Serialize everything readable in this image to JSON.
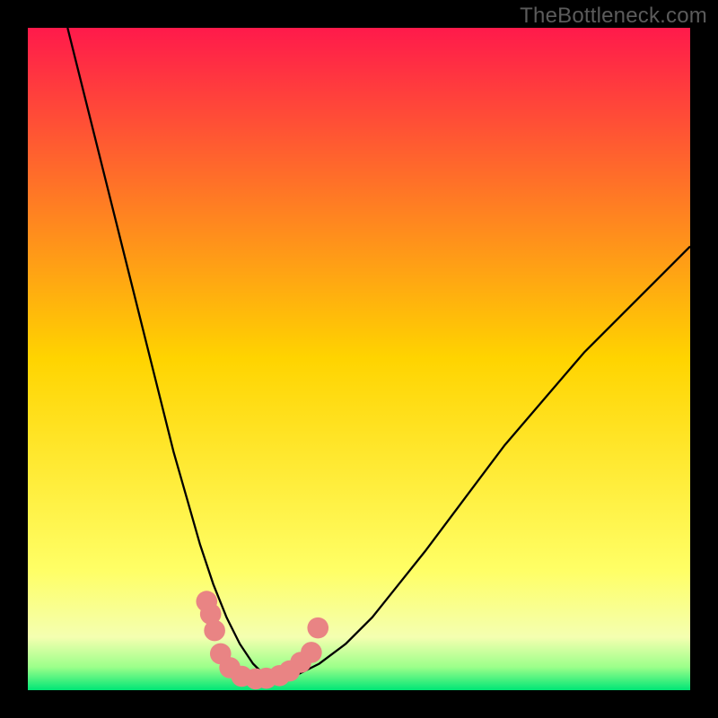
{
  "watermark": "TheBottleneck.com",
  "chart_data": {
    "type": "line",
    "title": "",
    "xlabel": "",
    "ylabel": "",
    "xlim": [
      0,
      100
    ],
    "ylim": [
      0,
      100
    ],
    "grid": false,
    "gradient_stops": [
      {
        "offset": 0,
        "color": "#ff1a4b"
      },
      {
        "offset": 50,
        "color": "#ffd400"
      },
      {
        "offset": 82,
        "color": "#ffff66"
      },
      {
        "offset": 92,
        "color": "#f4ffb0"
      },
      {
        "offset": 96.5,
        "color": "#9cff8a"
      },
      {
        "offset": 100,
        "color": "#00e676"
      }
    ],
    "series": [
      {
        "name": "bottleneck-curve",
        "x": [
          6,
          8,
          10,
          12,
          14,
          16,
          18,
          20,
          22,
          24,
          26,
          28,
          30,
          32,
          34,
          36,
          40,
          44,
          48,
          52,
          56,
          60,
          66,
          72,
          78,
          84,
          90,
          96,
          100
        ],
        "y": [
          100,
          92,
          84,
          76,
          68,
          60,
          52,
          44,
          36,
          29,
          22,
          16,
          11,
          7,
          4,
          2,
          2,
          4,
          7,
          11,
          16,
          21,
          29,
          37,
          44,
          51,
          57,
          63,
          67
        ]
      }
    ],
    "markers": {
      "name": "sample-points",
      "color": "#e98484",
      "radius_pct": 1.6,
      "points": [
        {
          "x": 27.0,
          "y": 13.4
        },
        {
          "x": 27.6,
          "y": 11.5
        },
        {
          "x": 28.2,
          "y": 9.0
        },
        {
          "x": 29.1,
          "y": 5.5
        },
        {
          "x": 30.5,
          "y": 3.4
        },
        {
          "x": 32.3,
          "y": 2.1
        },
        {
          "x": 34.4,
          "y": 1.7
        },
        {
          "x": 36.0,
          "y": 1.8
        },
        {
          "x": 38.0,
          "y": 2.2
        },
        {
          "x": 39.5,
          "y": 2.9
        },
        {
          "x": 41.2,
          "y": 4.2
        },
        {
          "x": 42.8,
          "y": 5.7
        },
        {
          "x": 43.8,
          "y": 9.4
        }
      ]
    }
  }
}
